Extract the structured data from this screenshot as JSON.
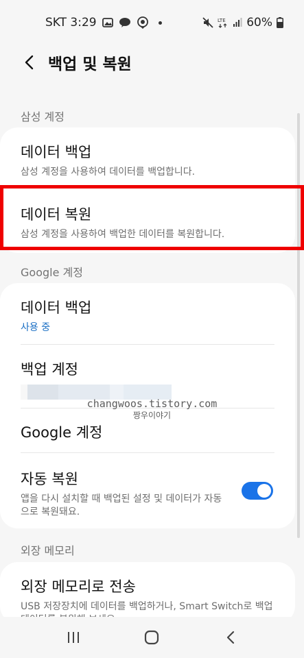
{
  "status": {
    "carrier_time": "SKT 3:29",
    "network": "LTE",
    "battery": "60%"
  },
  "header": {
    "title": "백업 및 복원"
  },
  "samsung": {
    "label": "삼성 계정",
    "backup": {
      "title": "데이터 백업",
      "sub": "삼성 계정을 사용하여 데이터를 백업합니다."
    },
    "restore": {
      "title": "데이터 복원",
      "sub": "삼성 계정을 사용하여 백업한 데이터를 복원합니다."
    }
  },
  "google": {
    "label": "Google 계정",
    "backup": {
      "title": "데이터 백업",
      "sub": "사용 중"
    },
    "account": {
      "title": "백업 계정"
    },
    "google_account": {
      "title": "Google 계정"
    },
    "auto_restore": {
      "title": "자동 복원",
      "sub": "앱을 다시 설치할 때 백업된 설정 및 데이터가 자동으로 복원돼요.",
      "enabled": true
    }
  },
  "watermark": {
    "url": "changwoos.tistory.com",
    "name": "짱우이야기"
  },
  "external": {
    "label": "외장 메모리",
    "transfer": {
      "title": "외장 메모리로 전송",
      "sub": "USB 저장장치에 데이터를 백업하거나, Smart Switch로 백업 데이터를 복원해 보세요."
    }
  },
  "colors": {
    "accent": "#1a73e8",
    "highlight": "#ef0000",
    "background": "#f6f6f6"
  }
}
